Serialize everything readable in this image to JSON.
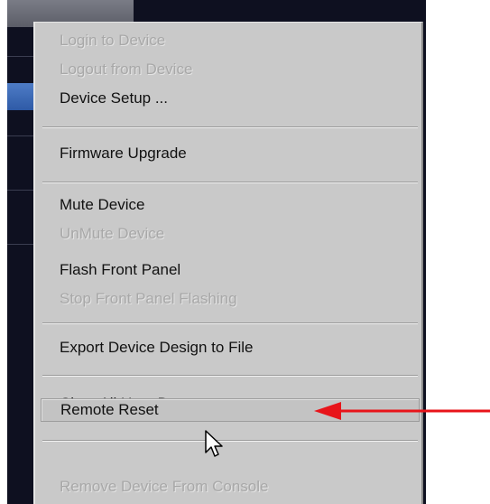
{
  "menu": {
    "items": [
      {
        "label": "Login to Device",
        "enabled": false
      },
      {
        "label": "Logout from Device",
        "enabled": false
      },
      {
        "label": "Device Setup ...",
        "enabled": true
      },
      {
        "label": "Firmware Upgrade",
        "enabled": true
      },
      {
        "label": "Mute Device",
        "enabled": true
      },
      {
        "label": "UnMute Device",
        "enabled": false
      },
      {
        "label": "Flash Front Panel",
        "enabled": true
      },
      {
        "label": "Stop Front Panel Flashing",
        "enabled": false
      },
      {
        "label": "Export Device Design to File",
        "enabled": true
      },
      {
        "label": "Clear All User Data",
        "enabled": true
      },
      {
        "label": "Remote Reset",
        "enabled": true,
        "hovered": true
      },
      {
        "label": "Remove Device From Console",
        "enabled": false
      }
    ]
  },
  "annotation": {
    "arrow_color": "#e8141a",
    "points_to": "Remote Reset"
  },
  "cursor": {
    "icon": "arrow-pointer-icon"
  },
  "colors": {
    "menu_background": "#c9c9c9",
    "enabled_text": "#111111",
    "disabled_text": "#a8a8a8",
    "app_background": "#0e1020",
    "selection_blue": "#2e5aa6"
  }
}
